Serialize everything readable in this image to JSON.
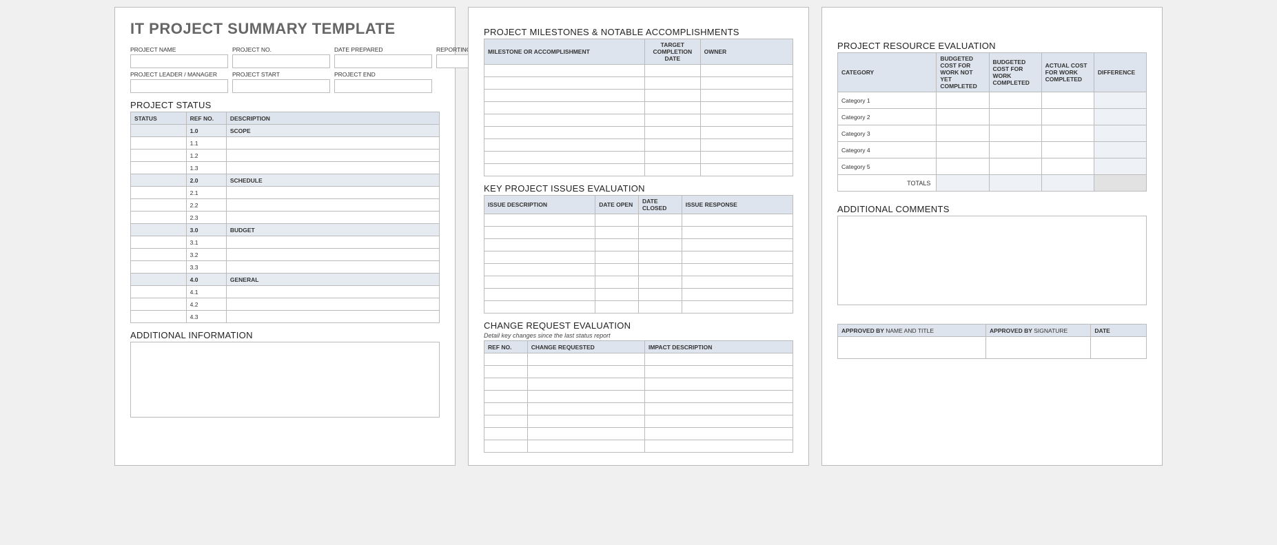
{
  "page1": {
    "title": "IT PROJECT SUMMARY TEMPLATE",
    "fields_row1": {
      "project_name": "PROJECT NAME",
      "project_no": "PROJECT NO.",
      "date_prepared": "DATE PREPARED",
      "reporting_period": "REPORTING PERIOD"
    },
    "fields_row2": {
      "project_leader": "PROJECT LEADER / MANAGER",
      "project_start": "PROJECT START",
      "project_end": "PROJECT END"
    },
    "status": {
      "heading": "PROJECT STATUS",
      "cols": {
        "status": "STATUS",
        "ref": "REF NO.",
        "desc": "DESCRIPTION"
      },
      "rows": [
        {
          "ref": "1.0",
          "desc": "SCOPE",
          "section": true
        },
        {
          "ref": "1.1",
          "desc": ""
        },
        {
          "ref": "1.2",
          "desc": ""
        },
        {
          "ref": "1.3",
          "desc": ""
        },
        {
          "ref": "2.0",
          "desc": "SCHEDULE",
          "section": true
        },
        {
          "ref": "2.1",
          "desc": ""
        },
        {
          "ref": "2.2",
          "desc": ""
        },
        {
          "ref": "2.3",
          "desc": ""
        },
        {
          "ref": "3.0",
          "desc": "BUDGET",
          "section": true
        },
        {
          "ref": "3.1",
          "desc": ""
        },
        {
          "ref": "3.2",
          "desc": ""
        },
        {
          "ref": "3.3",
          "desc": ""
        },
        {
          "ref": "4.0",
          "desc": "GENERAL",
          "section": true
        },
        {
          "ref": "4.1",
          "desc": ""
        },
        {
          "ref": "4.2",
          "desc": ""
        },
        {
          "ref": "4.3",
          "desc": ""
        }
      ]
    },
    "additional_info": "ADDITIONAL INFORMATION"
  },
  "page2": {
    "milestones": {
      "heading": "PROJECT MILESTONES & NOTABLE ACCOMPLISHMENTS",
      "cols": {
        "item": "MILESTONE OR ACCOMPLISHMENT",
        "target": "TARGET COMPLETION DATE",
        "owner": "OWNER"
      },
      "rowcount": 9
    },
    "issues": {
      "heading": "KEY PROJECT ISSUES EVALUATION",
      "cols": {
        "desc": "ISSUE DESCRIPTION",
        "open": "DATE OPEN",
        "closed": "DATE CLOSED",
        "response": "ISSUE RESPONSE"
      },
      "rowcount": 8
    },
    "changes": {
      "heading": "CHANGE REQUEST EVALUATION",
      "sub": "Detail key changes since the last status report",
      "cols": {
        "ref": "REF NO.",
        "req": "CHANGE REQUESTED",
        "impact": "IMPACT DESCRIPTION"
      },
      "rowcount": 8
    }
  },
  "page3": {
    "resource": {
      "heading": "PROJECT RESOURCE EVALUATION",
      "cols": {
        "cat": "CATEGORY",
        "b_not": "BUDGETED COST FOR WORK NOT YET COMPLETED",
        "b_done": "BUDGETED COST FOR WORK COMPLETED",
        "actual": "ACTUAL COST FOR WORK COMPLETED",
        "diff": "DIFFERENCE"
      },
      "rows": [
        "Category 1",
        "Category 2",
        "Category 3",
        "Category 4",
        "Category 5"
      ],
      "totals": "TOTALS"
    },
    "comments": "ADDITIONAL COMMENTS",
    "approval": {
      "name_label_bold": "APPROVED BY",
      "name_label_rest": " NAME AND TITLE",
      "sig_label_bold": "APPROVED BY",
      "sig_label_rest": " SIGNATURE",
      "date": "DATE"
    }
  }
}
